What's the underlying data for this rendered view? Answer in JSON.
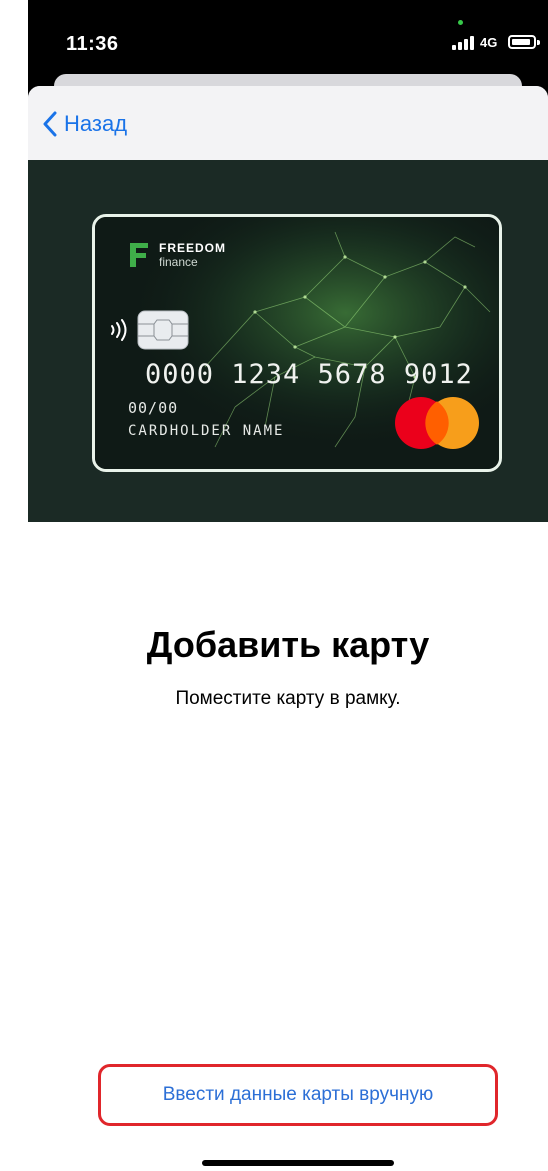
{
  "status_bar": {
    "time": "11:36",
    "network": "4G"
  },
  "nav": {
    "back_label": "Назад"
  },
  "card": {
    "brand_top": "FREEDOM",
    "brand_bottom": "finance",
    "number": "0000 1234 5678 9012",
    "expiry": "00/00",
    "holder": "CARDHOLDER NAME",
    "network_logo": "mastercard-logo"
  },
  "content": {
    "title": "Добавить карту",
    "subtitle": "Поместите карту в рамку."
  },
  "actions": {
    "manual_entry_label": "Ввести данные карты вручную"
  },
  "colors": {
    "link_blue": "#1a73e8",
    "highlight_red": "#e0262b",
    "brand_green": "#3fae49",
    "camera_bg": "#1b2a25"
  }
}
